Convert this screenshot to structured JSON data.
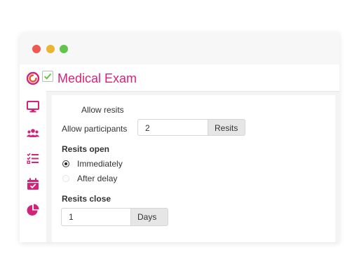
{
  "window": {
    "title": "Medical Exam"
  },
  "colors": {
    "accent": "#d4247a",
    "close": "#ec5a52",
    "minimize": "#e7b632",
    "maximize": "#62c44a"
  },
  "sidebar": {
    "icons": [
      "logo-icon",
      "monitor-icon",
      "users-icon",
      "checklist-icon",
      "calendar-icon",
      "pie-chart-icon"
    ]
  },
  "form": {
    "allow_resits": {
      "label": "Allow resits",
      "checked": true
    },
    "allow_participants": {
      "label": "Allow participants",
      "value": "2",
      "unit": "Resits"
    },
    "resits_open": {
      "heading": "Resits open",
      "options": [
        {
          "label": "Immediately",
          "selected": true
        },
        {
          "label": "After delay",
          "selected": false
        }
      ]
    },
    "resits_close": {
      "heading": "Resits close",
      "value": "1",
      "unit": "Days"
    }
  }
}
